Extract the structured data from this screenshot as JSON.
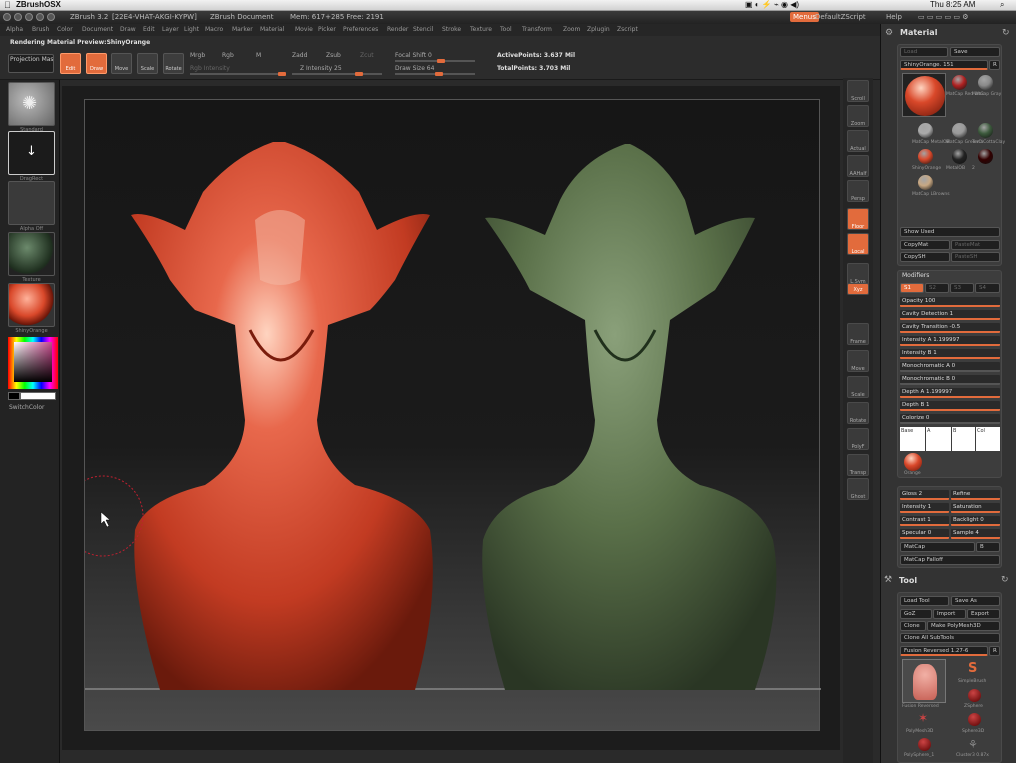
{
  "mac": {
    "app": "ZBrushOSX",
    "clock": "Thu 8:25 AM"
  },
  "title": {
    "version": "ZBrush 3.2",
    "serial": "[22E4-VHAT-AKGI-KYPW]",
    "doc": "ZBrush Document",
    "mem": "Mem: 617+285 Free: 2191",
    "macro": "Menus",
    "script": "DefaultZScript",
    "help": "Help"
  },
  "menus": [
    "Alpha",
    "Brush",
    "Color",
    "Document",
    "Draw",
    "Edit",
    "Layer",
    "Light",
    "Macro",
    "Marker",
    "Material",
    "Movie",
    "Picker",
    "Preferences",
    "Render",
    "Stencil",
    "Stroke",
    "Texture",
    "Tool",
    "Transform",
    "Zoom",
    "Zplugin",
    "Zscript"
  ],
  "toolbar": {
    "status": "Rendering Material Preview:ShinyOrange",
    "projection": "Projection Master",
    "buttons": [
      {
        "label": "Edit",
        "icon": "edit-icon"
      },
      {
        "label": "Draw",
        "icon": "draw-icon"
      },
      {
        "label": "Move",
        "icon": "move-icon"
      },
      {
        "label": "Scale",
        "icon": "scale-icon"
      },
      {
        "label": "Rotate",
        "icon": "rotate-icon"
      }
    ],
    "mrgb": "Mrgb",
    "rgb": "Rgb",
    "m": "M",
    "rgb_intensity": "Rgb Intensity",
    "zadd": "Zadd",
    "zsub": "Zsub",
    "zcut": "Zcut",
    "z_intensity": "Z Intensity 25",
    "z_intensity_value": 25,
    "focal_shift": "Focal Shift 0",
    "draw_size": "Draw Size 64",
    "active_points": "ActivePoints: 3.637 Mil",
    "total_points": "TotalPoints: 3.703 Mil"
  },
  "leftshelf": {
    "brush": "Standard",
    "stroke": "DragRect",
    "alpha": "Alpha Off",
    "texture": "Texture",
    "material": "ShinyOrange",
    "switch_color": "SwitchColor"
  },
  "rightshelf": [
    "Scroll",
    "Zoom",
    "Actual",
    "AAHalf",
    "Persp",
    "Floor",
    "Local",
    "L.Sym",
    "Xyz",
    "Frame",
    "Move",
    "Scale",
    "Rotate",
    "PolyF",
    "Transp",
    "Ghost",
    "Xpose"
  ],
  "material_panel": {
    "title": "Material",
    "load": "Load",
    "save": "Save",
    "current": "ShinyOrange. 151",
    "r": "R",
    "items": [
      {
        "name": "ShinyOrange",
        "color": "#d9482a"
      },
      {
        "name": "MatCap Red Wax",
        "color": "#b02222"
      },
      {
        "name": "MatCap Gray",
        "color": "#8a8a8a"
      },
      {
        "name": "MatCap MetalOB",
        "color": "#aaaaaa"
      },
      {
        "name": "MatCap GreenCl",
        "color": "#9a9a9a"
      },
      {
        "name": "TerraCottaClay",
        "color": "#3c5a3c"
      },
      {
        "name": "ShinyOrange",
        "color": "#d9482a"
      },
      {
        "name": "MetalOB",
        "color": "#222222"
      },
      {
        "name": "2",
        "color": "#330000"
      },
      {
        "name": "MatCap LBrowns",
        "color": "#c8a883"
      }
    ],
    "show_used": "Show Used",
    "copy_mat": "CopyMat",
    "paste_mat": "PasteMat",
    "copy_sh": "CopySH",
    "paste_sh": "PasteSH"
  },
  "modifiers": {
    "title": "Modifiers",
    "tabs": [
      "S1",
      "S2",
      "S3",
      "S4"
    ],
    "rows": [
      "Opacity 100",
      "Cavity Detection 1",
      "Cavity Transition -0.5",
      "Intensity A 1.199997",
      "Intensity B 1",
      "Monochromatic A 0",
      "Monochromatic B 0",
      "Depth A 1.199997",
      "Depth B 1",
      "Colorize 0"
    ],
    "channels": [
      "Base",
      "A",
      "B",
      "Col"
    ],
    "orange": "Orange"
  },
  "gloss": {
    "rows": [
      [
        "Gloss 2",
        "Refine"
      ],
      [
        "Intensity 1",
        "Saturation"
      ],
      [
        "Contrast 1",
        "Backlight 0"
      ],
      [
        "Specular 0",
        "Sample 4"
      ]
    ],
    "matcap": "MatCap",
    "b": "B",
    "falloff": "MatCap Falloff"
  },
  "tool_panel": {
    "title": "Tool",
    "load": "Load Tool",
    "save_as": "Save As",
    "goz": "GoZ",
    "import": "Import",
    "export": "Export",
    "clone": "Clone",
    "make_poly": "Make PolyMesh3D",
    "clone_all": "Clone All SubTools",
    "fusion": "Fusion Reversed 1.27-6",
    "r": "R",
    "items": [
      "Fusion Reversed",
      "SimpleBrush",
      "ZSphere",
      "PolyMesh3D",
      "Sphere3D",
      "PolySphere_1",
      "Cluster3 0.87x"
    ]
  }
}
